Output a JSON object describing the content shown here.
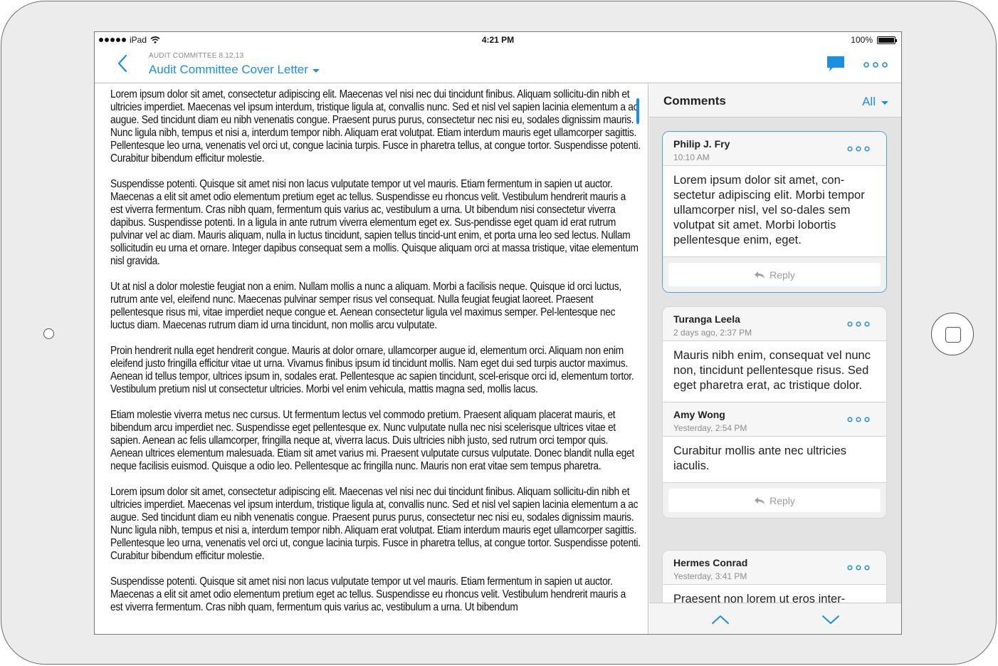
{
  "status": {
    "carrier": "iPad",
    "time": "4:21 PM",
    "battery": "100%",
    "battery_level": 1.0
  },
  "nav": {
    "subtitle": "AUDIT COMMITTEE 8.12.13",
    "title": "Audit Committee Cover Letter"
  },
  "document": {
    "paragraphs": [
      "Lorem ipsum dolor sit amet, consectetur adipiscing elit. Maecenas vel nisi nec dui tincidunt finibus. Aliquam sollicitu-din nibh et ultricies imperdiet. Maecenas vel ipsum interdum, tristique ligula at, convallis nunc. Sed et nisl vel sapien lacinia elementum a ac augue. Sed tincidunt diam eu nibh venenatis congue. Praesent purus purus, consectetur nec nisi eu, sodales dignissim mauris. Nunc ligula nibh, tempus et nisi a, interdum tempor nibh. Aliquam erat volutpat. Etiam interdum mauris eget ullamcorper sagittis. Pellentesque leo urna, venenatis vel orci ut, congue lacinia turpis. Fusce in pharetra tellus, at congue tortor. Suspendisse potenti. Curabitur bibendum efficitur molestie.",
      "Suspendisse potenti. Quisque sit amet nisi non lacus vulputate tempor ut vel mauris. Etiam fermentum in sapien ut auctor. Maecenas a elit sit amet odio elementum pretium eget ac tellus. Suspendisse eu rhoncus velit. Vestibulum hendrerit mauris a est viverra fermentum. Cras nibh quam, fermentum quis varius ac, vestibulum a urna. Ut bibendum nisi consectetur viverra dapibus. Suspendisse potenti. In a ligula in ante rutrum viverra elementum eget ex. Sus-pendisse eget quam id erat rutrum pulvinar vel ac diam. Mauris aliquam, nulla in luctus tincidunt, sapien tellus tincid-unt enim, et porta urna leo sed lectus. Nullam sollicitudin eu urna et ornare. Integer dapibus consequat sem a mollis. Quisque aliquam orci at massa tristique, vitae elementum nisl gravida.",
      "Ut at nisl a dolor molestie feugiat non a enim. Nullam mollis a nunc a aliquam. Morbi a facilisis neque. Quisque id orci luctus, rutrum ante vel, eleifend nunc. Maecenas pulvinar semper risus vel consequat. Nulla feugiat feugiat laoreet. Praesent pellentesque risus mi, vitae imperdiet neque congue et. Aenean consectetur ligula vel maximus semper. Pel-lentesque nec luctus diam. Maecenas rutrum diam id urna tincidunt, non mollis arcu vulputate.",
      "Proin hendrerit nulla eget hendrerit congue. Mauris at dolor ornare, ullamcorper augue id, elementum orci. Aliquam non enim eleifend justo fringilla efficitur vitae ut urna. Vivamus finibus ipsum id tincidunt mollis. Nam eget dui sed turpis auctor maximus. Aenean id tellus tempor, ultrices ipsum in, sodales erat. Pellentesque ac sapien tincidunt, scel-erisque orci id, elementum tortor. Vestibulum pretium nisl ut consectetur ultricies. Morbi vel enim vehicula, mattis magna sed, mollis lacus.",
      "Etiam molestie viverra metus nec cursus. Ut fermentum lectus vel commodo pretium. Praesent aliquam placerat mauris, et bibendum arcu imperdiet nec. Suspendisse eget pellentesque ex. Nunc vulputate nulla nec nisi scelerisque ultrices vitae et sapien. Aenean ac felis ullamcorper, fringilla neque at, viverra lacus. Duis ultricies nibh justo, sed rutrum orci tempor quis. Aenean ultrices elementum malesuada. Etiam sit amet varius mi. Praesent vulputate cursus vulputate. Donec blandit nulla eget neque facilisis euismod. Quisque a odio leo. Pellentesque ac fringilla nunc. Mauris non erat vitae sem tempus pharetra.",
      "Lorem ipsum dolor sit amet, consectetur adipiscing elit. Maecenas vel nisi nec dui tincidunt finibus. Aliquam sollicitu-din nibh et ultricies imperdiet. Maecenas vel ipsum interdum, tristique ligula at, convallis nunc. Sed et nisl vel sapien lacinia elementum a ac augue. Sed tincidunt diam eu nibh venenatis congue. Praesent purus purus, consectetur nec nisi eu, sodales dignissim mauris. Nunc ligula nibh, tempus et nisi a, interdum tempor nibh. Aliquam erat volutpat. Etiam interdum mauris eget ullamcorper sagittis. Pellentesque leo urna, venenatis vel orci ut, congue lacinia turpis. Fusce in pharetra tellus, at congue tortor. Suspendisse potenti. Curabitur bibendum efficitur molestie.",
      "Suspendisse potenti. Quisque sit amet nisi non lacus vulputate tempor ut vel mauris. Etiam fermentum in sapien ut auctor. Maecenas a elit sit amet odio elementum pretium eget ac tellus. Suspendisse eu rhoncus velit. Vestibulum hendrerit mauris a est viverra fermentum. Cras nibh quam, fermentum quis varius ac, vestibulum a urna. Ut bibendum"
    ]
  },
  "comments": {
    "title": "Comments",
    "filter": "All",
    "reply_label": "Reply",
    "threads": [
      {
        "name": "Philip J. Fry",
        "time": "10:10 AM",
        "body": "Lorem ipsum dolor sit amet, con-sectetur adipiscing elit. Morbi tempor ullamcorper nisl, vel so-dales sem volutpat sit amet. Morbi lobortis pellentesque enim, eget."
      },
      {
        "name": "Turanga Leela",
        "time": "2 days ago, 2:37 PM",
        "body": "Mauris nibh enim, consequat vel nunc non, tincidunt pellentesque risus. Sed eget pharetra erat, ac tristique dolor."
      },
      {
        "name": "Amy Wong",
        "time": "Yesterday, 2:54 PM",
        "body": "Curabitur mollis ante nec ultricies iaculis."
      },
      {
        "name": "Hermes Conrad",
        "time": "Yesterday, 3:41 PM",
        "body": "Praesent non lorem ut eros inter-"
      }
    ]
  },
  "colors": {
    "accent": "#1a8fe3",
    "pane_background": "#e3e3e3",
    "active_border": "#4aa3e8"
  },
  "icons": [
    "back-chevron-icon",
    "comment-bubble-icon",
    "more-icon",
    "reply-arrow-icon",
    "chevron-up-icon",
    "chevron-down-icon",
    "wifi-icon",
    "battery-icon"
  ]
}
